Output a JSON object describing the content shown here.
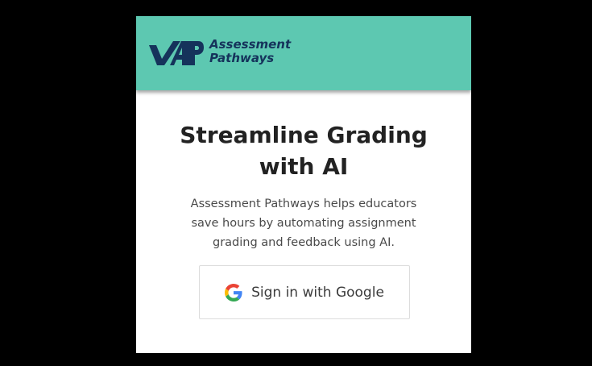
{
  "brand": {
    "line1": "Assessment",
    "line2": "Pathways",
    "header_color": "#5dc8b1",
    "logo_color": "#15335b",
    "logo_icon": "vap-logo-icon"
  },
  "hero": {
    "headline": "Streamline Grading with AI",
    "description": "Assessment Pathways helps educators save hours by automating assignment grading and feedback using AI."
  },
  "auth": {
    "google_button_label": "Sign in with Google",
    "google_icon": "google-g-icon"
  }
}
